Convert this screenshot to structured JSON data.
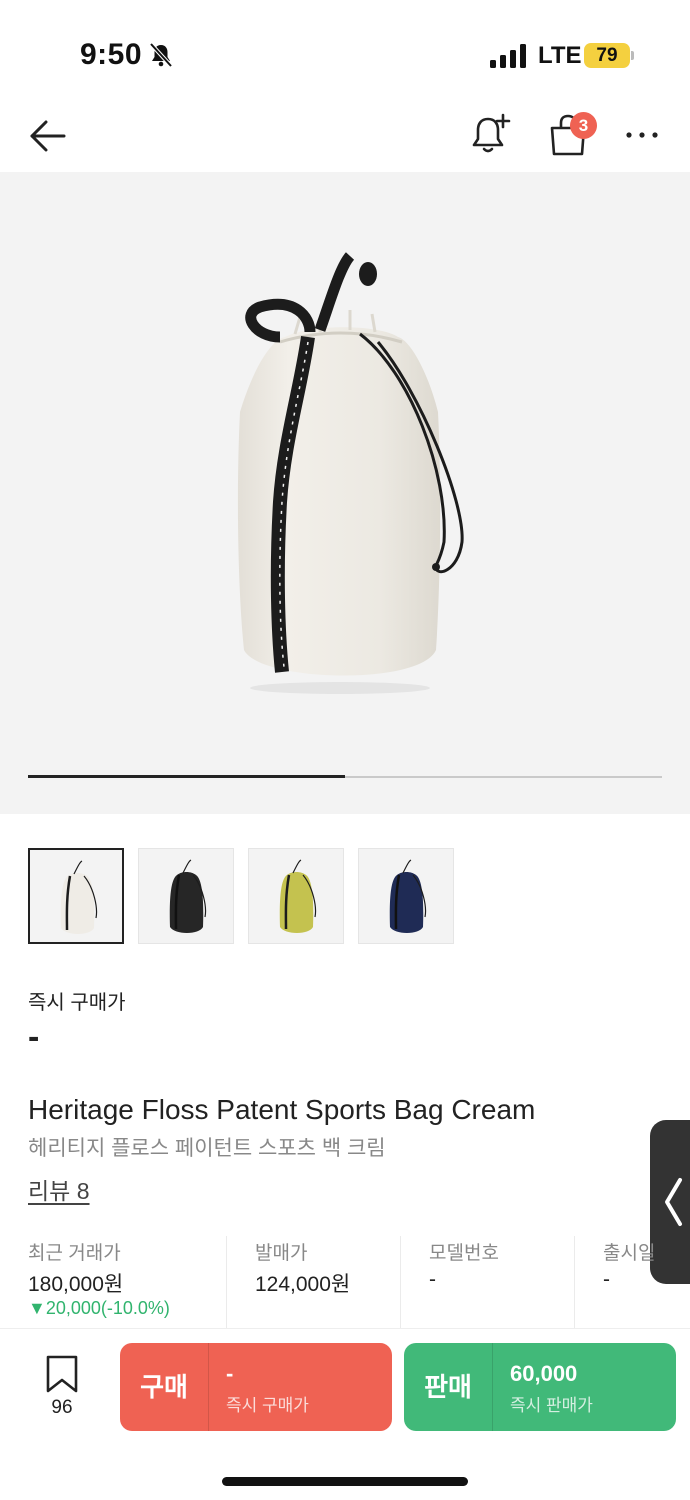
{
  "status_bar": {
    "time": "9:50",
    "network": "LTE",
    "battery": "79"
  },
  "nav": {
    "cart_badge": "3"
  },
  "gallery": {
    "progress": 0.5,
    "thumbnails": [
      "cream",
      "black",
      "lime",
      "navy"
    ],
    "selected_index": 0,
    "colors": {
      "cream": "#efece6",
      "black": "#262626",
      "lime": "#c4c24f",
      "navy": "#1f2b55"
    }
  },
  "price": {
    "label": "즉시 구매가",
    "value": "-"
  },
  "product": {
    "title_en": "Heritage Floss Patent Sports Bag Cream",
    "title_ko": "헤리티지 플로스 페이턴트 스포츠 백 크림",
    "review_label": "리뷰 8"
  },
  "info": {
    "recent": {
      "label": "최근 거래가",
      "value": "180,000원",
      "change": "▼20,000(-10.0%)"
    },
    "release_price": {
      "label": "발매가",
      "value": "124,000원"
    },
    "model": {
      "label": "모델번호",
      "value": "-"
    },
    "release_date": {
      "label": "출시일",
      "value": "-"
    }
  },
  "bottom": {
    "wish_count": "96",
    "buy": {
      "label": "구매",
      "price": "-",
      "sub": "즉시 구매가"
    },
    "sell": {
      "label": "판매",
      "price": "60,000",
      "sub": "즉시 판매가"
    }
  },
  "theme": {
    "buy_color": "#ef6253",
    "sell_color": "#41b979",
    "change_color": "#31b46e"
  }
}
